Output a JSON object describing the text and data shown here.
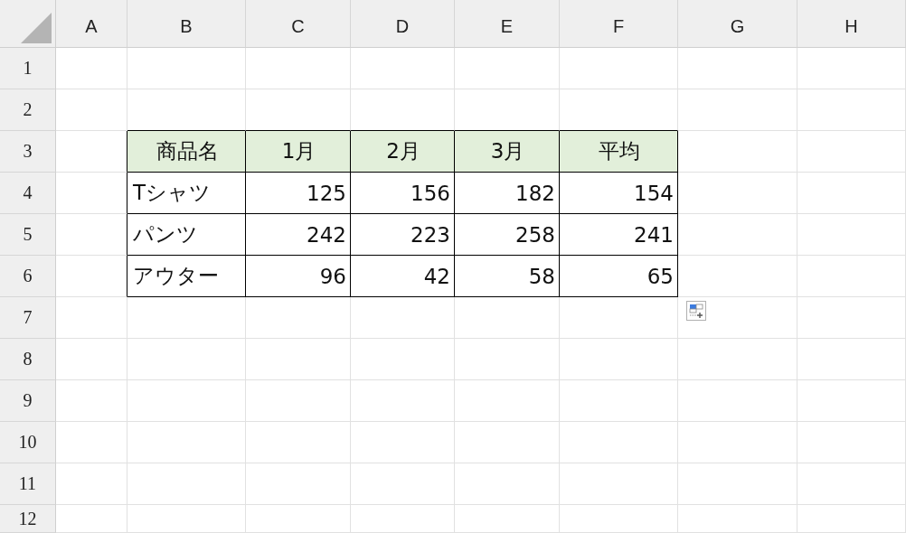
{
  "columns": [
    "A",
    "B",
    "C",
    "D",
    "E",
    "F",
    "G",
    "H"
  ],
  "rows": [
    "1",
    "2",
    "3",
    "4",
    "5",
    "6",
    "7",
    "8",
    "9",
    "10",
    "11",
    "12"
  ],
  "table": {
    "header": [
      "商品名",
      "1月",
      "2月",
      "3月",
      "平均"
    ],
    "rows": [
      {
        "name": "Tシャツ",
        "values": [
          "125",
          "156",
          "182",
          "154"
        ]
      },
      {
        "name": "パンツ",
        "values": [
          "242",
          "223",
          "258",
          "241"
        ]
      },
      {
        "name": "アウター",
        "values": [
          "96",
          "42",
          "58",
          "65"
        ]
      }
    ]
  }
}
